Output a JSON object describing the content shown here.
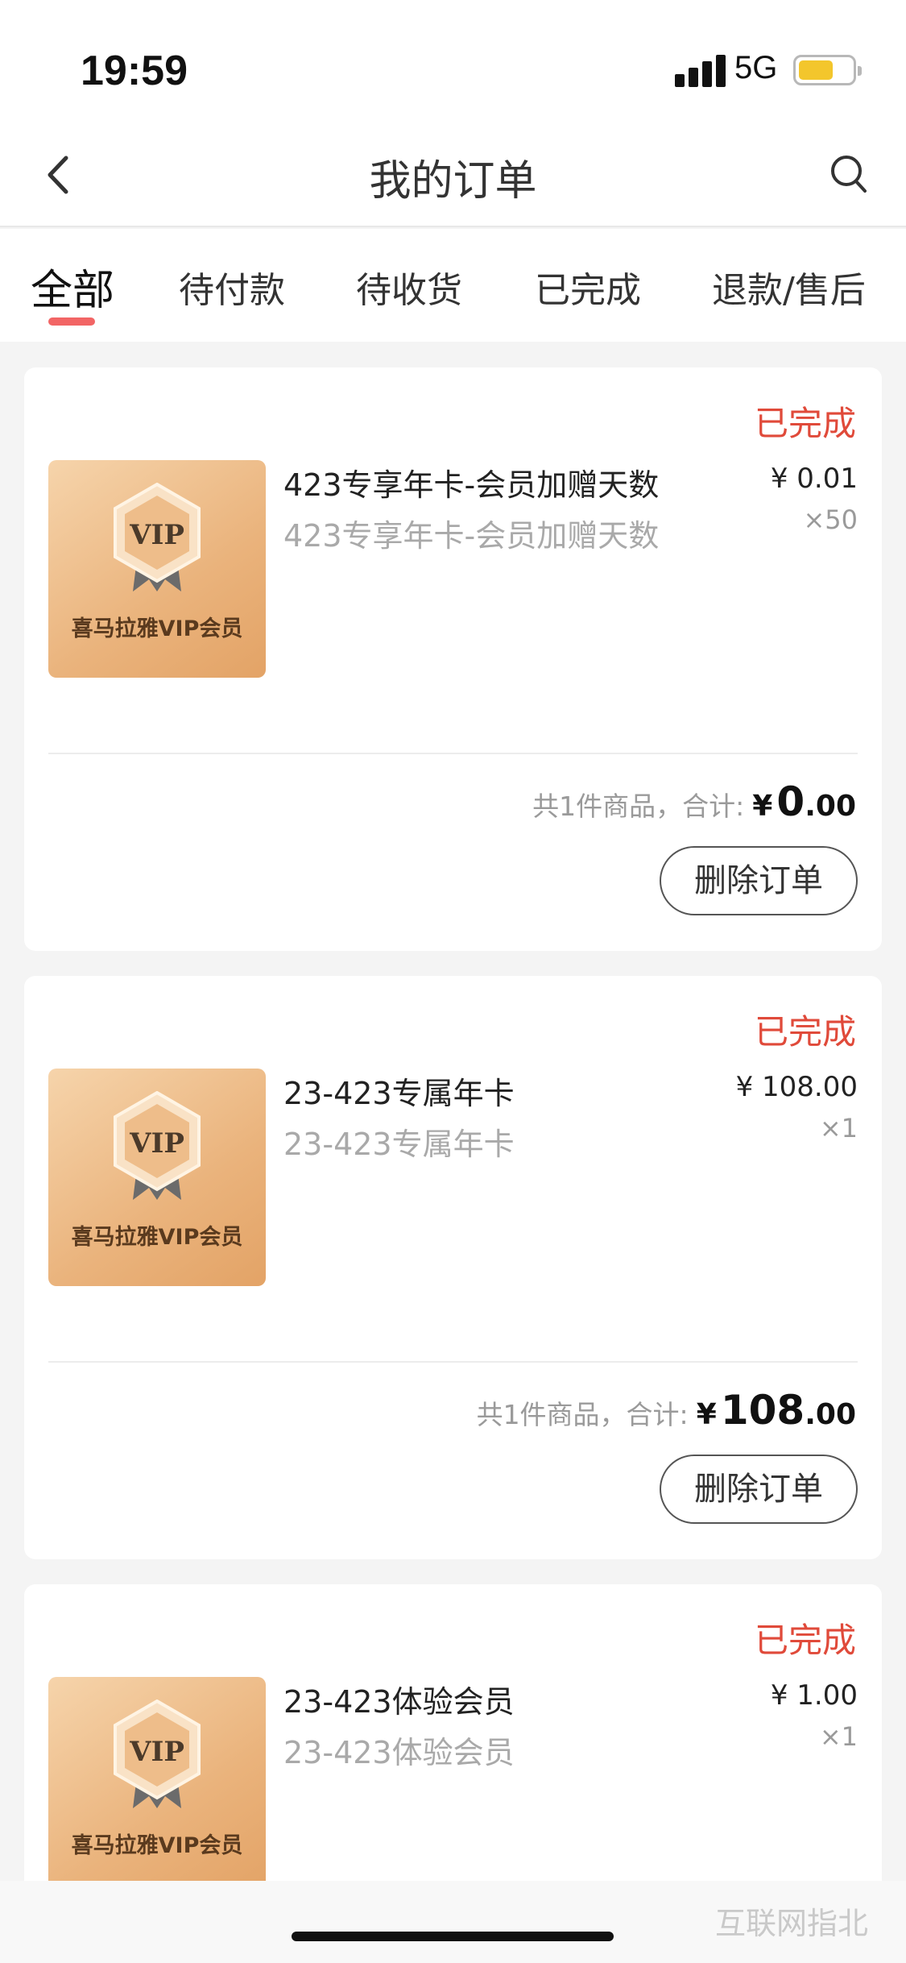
{
  "status_bar": {
    "time": "19:59",
    "network": "5G",
    "battery_color": "#f3c62c"
  },
  "nav": {
    "title": "我的订单",
    "back_icon": "chevron-left-icon",
    "search_icon": "search-icon"
  },
  "tabs": [
    {
      "label": "全部",
      "active": true
    },
    {
      "label": "待付款",
      "active": false
    },
    {
      "label": "待收货",
      "active": false
    },
    {
      "label": "已完成",
      "active": false
    },
    {
      "label": "退款/售后",
      "active": false
    }
  ],
  "orders": [
    {
      "status": "已完成",
      "thumb_badge": "VIP",
      "thumb_caption": "喜马拉雅VIP会员",
      "title": "423专享年卡-会员加赠天数",
      "subtitle": "423专享年卡-会员加赠天数",
      "price": "¥ 0.01",
      "qty": "×50",
      "summary_label": "共1件商品，合计:",
      "currency": "¥",
      "total_int": "0",
      "total_dec": ".00",
      "delete_label": "删除订单"
    },
    {
      "status": "已完成",
      "thumb_badge": "VIP",
      "thumb_caption": "喜马拉雅VIP会员",
      "title": "23-423专属年卡",
      "subtitle": "23-423专属年卡",
      "price": "¥ 108.00",
      "qty": "×1",
      "summary_label": "共1件商品，合计:",
      "currency": "¥",
      "total_int": "108",
      "total_dec": ".00",
      "delete_label": "删除订单"
    },
    {
      "status": "已完成",
      "thumb_badge": "VIP",
      "thumb_caption": "喜马拉雅VIP会员",
      "title": "23-423体验会员",
      "subtitle": "23-423体验会员",
      "price": "¥ 1.00",
      "qty": "×1"
    }
  ],
  "watermark": "互联网指北",
  "colors": {
    "accent": "#e04a3a",
    "tab_indicator": "#f26565",
    "background": "#f4f4f4"
  }
}
